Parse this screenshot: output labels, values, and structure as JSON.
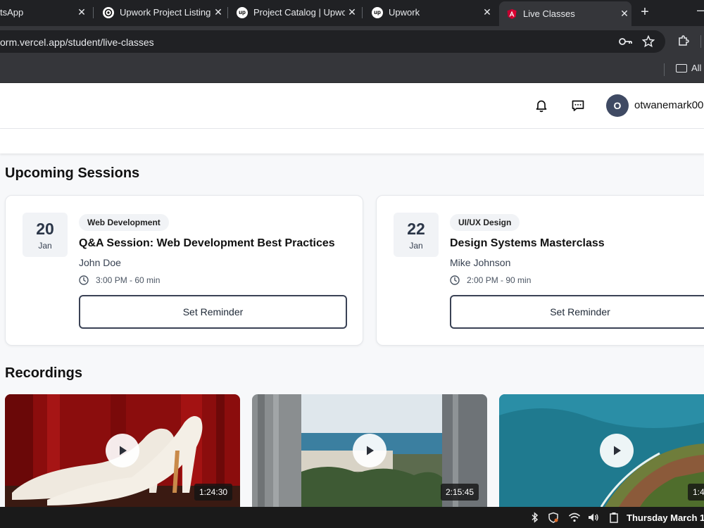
{
  "browser": {
    "tabs": [
      {
        "title": "tsApp",
        "favicon": "whatsapp-icon",
        "active": false
      },
      {
        "title": "Upwork Project Listing",
        "favicon": "openai-icon",
        "active": false
      },
      {
        "title": "Project Catalog | Upwork",
        "favicon": "upwork-icon",
        "active": false
      },
      {
        "title": "Upwork",
        "favicon": "upwork-icon",
        "active": false
      },
      {
        "title": "Live Classes",
        "favicon": "angular-icon",
        "active": true
      }
    ],
    "close_glyph": "✕",
    "new_tab_glyph": "+",
    "favicon_text": "up",
    "url": "orm.vercel.app/student/live-classes",
    "bookmarks_folder": "All"
  },
  "header": {
    "avatar_initial": "O",
    "username": "otwanemark00"
  },
  "upcoming": {
    "title": "Upcoming Sessions",
    "sessions": [
      {
        "day": "20",
        "month": "Jan",
        "category": "Web Development",
        "title": "Q&A Session: Web Development Best Practices",
        "instructor": "John Doe",
        "time": "3:00 PM - 60 min",
        "button": "Set Reminder"
      },
      {
        "day": "22",
        "month": "Jan",
        "category": "UI/UX Design",
        "title": "Design Systems Masterclass",
        "instructor": "Mike Johnson",
        "time": "2:00 PM - 90 min",
        "button": "Set Reminder"
      }
    ]
  },
  "recordings": {
    "title": "Recordings",
    "items": [
      {
        "duration": "1:24:30",
        "thumbnail": "white-heels-red-wall"
      },
      {
        "duration": "2:15:45",
        "thumbnail": "coastal-city-view"
      },
      {
        "duration": "1:4",
        "thumbnail": "aerial-coastline"
      }
    ]
  },
  "taskbar": {
    "datetime": "Thursday March 1"
  },
  "colors": {
    "accent_dark": "#3f4a63",
    "chrome_bg": "#202124",
    "page_bg": "#f7f8fa"
  }
}
